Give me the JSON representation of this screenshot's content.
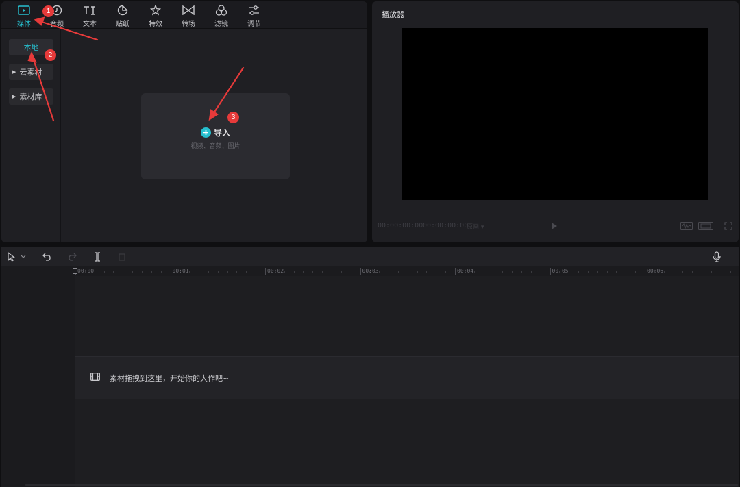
{
  "tool_tabs": [
    {
      "label": "媒体",
      "icon": "media-icon",
      "active": true
    },
    {
      "label": "音频",
      "icon": "audio-icon"
    },
    {
      "label": "文本",
      "icon": "text-icon"
    },
    {
      "label": "贴纸",
      "icon": "sticker-icon"
    },
    {
      "label": "特效",
      "icon": "effects-icon"
    },
    {
      "label": "转场",
      "icon": "transition-icon"
    },
    {
      "label": "滤镜",
      "icon": "filter-icon"
    },
    {
      "label": "调节",
      "icon": "adjust-icon"
    }
  ],
  "media_sidebar": {
    "items": [
      {
        "label": "本地",
        "active": true
      },
      {
        "label": "云素材",
        "collapsible": true
      },
      {
        "label": "素材库",
        "collapsible": true
      }
    ]
  },
  "import": {
    "label": "导入",
    "hint": "视频、音频、图片",
    "icon": "plus-icon"
  },
  "player": {
    "title": "播放器",
    "current_time": "00:00:00:00",
    "total_time": "00:00:00:00",
    "quality": "原画 ▾"
  },
  "timeline": {
    "ruler_labels": [
      "00:00",
      "00:01",
      "00:02",
      "00:03",
      "00:04",
      "00:05",
      "00:06"
    ],
    "main_track_hint": "素材拖拽到这里，开始你的大作吧~"
  },
  "annotations": {
    "badges": [
      "1",
      "2",
      "3"
    ],
    "color": "#e63a3a"
  },
  "colors": {
    "accent": "#27c0cf",
    "panel_bg": "#1f1f23",
    "app_bg": "#0f0f11"
  }
}
